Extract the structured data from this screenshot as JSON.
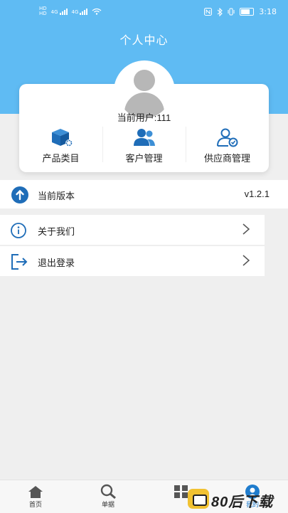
{
  "status_bar": {
    "sim1": "HD",
    "sim2": "HD",
    "net1": "4G",
    "net2": "4G",
    "time": "3:18"
  },
  "header": {
    "title": "个人中心"
  },
  "profile": {
    "current_user_label": "当前用户:",
    "current_user_value": "111"
  },
  "tiles": [
    {
      "label": "产品类目",
      "icon": "product-category-icon"
    },
    {
      "label": "客户管理",
      "icon": "customer-management-icon"
    },
    {
      "label": "供应商管理",
      "icon": "supplier-management-icon"
    }
  ],
  "version": {
    "label": "当前版本",
    "value": "v1.2.1",
    "icon": "upload-arrow-icon"
  },
  "menu": [
    {
      "label": "关于我们",
      "icon": "info-icon"
    },
    {
      "label": "退出登录",
      "icon": "logout-icon"
    }
  ],
  "tabbar": [
    {
      "label": "首页",
      "icon": "home-icon"
    },
    {
      "label": "单据",
      "icon": "search-icon"
    },
    {
      "label": "",
      "icon": "grid-icon"
    },
    {
      "label": "我的",
      "icon": "user-icon"
    }
  ],
  "watermark": {
    "text": "80后下载"
  },
  "colors": {
    "header_bg": "#5fbbf3",
    "accent_blue": "#1f7ccd",
    "page_bg": "#efefef"
  }
}
